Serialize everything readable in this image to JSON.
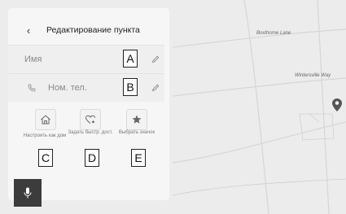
{
  "panel": {
    "title": "Редактирование пункта",
    "back_icon": "chevron-left-icon"
  },
  "fields": {
    "name": {
      "label": "Имя",
      "icon": "pencil-icon"
    },
    "phone": {
      "label": "Ном. тел.",
      "leading_icon": "phone-icon",
      "icon": "pencil-icon"
    }
  },
  "actions": [
    {
      "label": "Настроить как дом",
      "icon": "home-icon"
    },
    {
      "label": "Задать быстр. дост.",
      "icon": "heart-star-icon"
    },
    {
      "label": "Выбрать значок",
      "icon": "star-icon"
    }
  ],
  "callouts": {
    "a": "A",
    "b": "B",
    "c": "C",
    "d": "D",
    "e": "E"
  },
  "map": {
    "streets": [
      "Boxthorne Lane",
      "Wintersville Way"
    ],
    "pin_icon": "map-pin-icon"
  },
  "mic": {
    "icon": "microphone-icon"
  },
  "colors": {
    "map_background": "#ececec",
    "panel_background": "#f6f6f6",
    "mic_button": "#3c3c3c"
  }
}
